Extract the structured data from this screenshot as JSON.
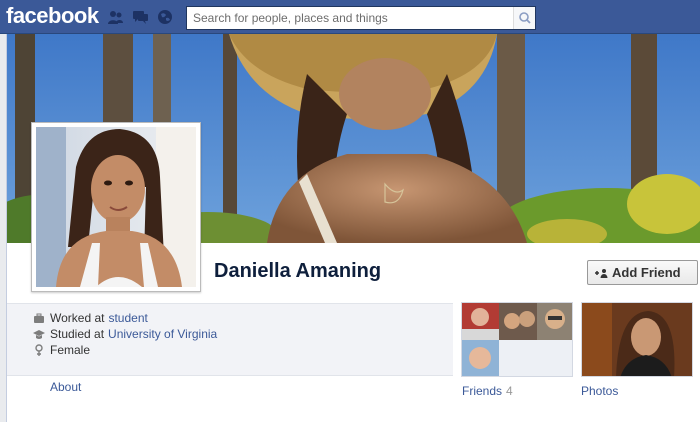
{
  "header": {
    "logo": "facebook",
    "search_placeholder": "Search for people, places and things",
    "icons": [
      "friend-requests-icon",
      "messages-icon",
      "notifications-globe-icon",
      "search-icon"
    ]
  },
  "profile": {
    "name": "Daniella Amaning",
    "add_friend_label": "Add Friend"
  },
  "info": {
    "work": {
      "prefix": "Worked at",
      "value": "student"
    },
    "education": {
      "prefix": "Studied at",
      "value": "University of Virginia"
    },
    "gender": {
      "value": "Female"
    }
  },
  "nav": {
    "about": "About"
  },
  "tiles": {
    "friends": {
      "label": "Friends",
      "count": "4"
    },
    "photos": {
      "label": "Photos"
    }
  },
  "colors": {
    "brand": "#3b5998",
    "link": "#3b5998",
    "name": "#0e1f3c",
    "info_bg": "#f2f3f7"
  }
}
